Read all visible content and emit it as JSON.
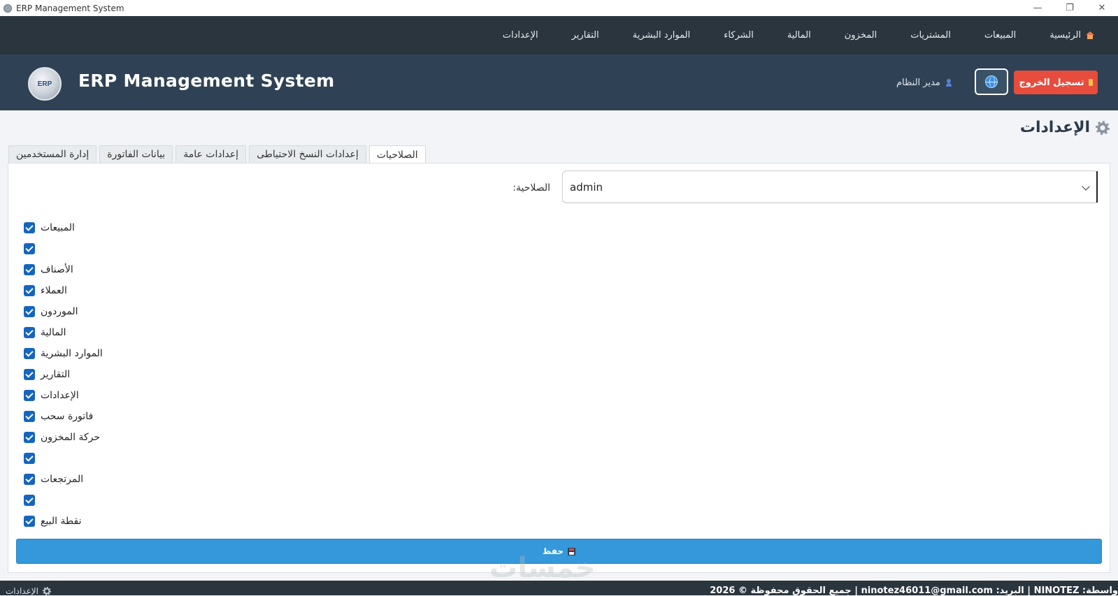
{
  "window": {
    "title": "ERP Management System",
    "controls": {
      "minimize": "—",
      "restore": "❐",
      "close": "✕"
    }
  },
  "nav": {
    "items": [
      {
        "label": "الرئيسية",
        "icon": "home-icon"
      },
      {
        "label": "المبيعات"
      },
      {
        "label": "المشتريات"
      },
      {
        "label": "المخزون"
      },
      {
        "label": "المالية"
      },
      {
        "label": "الشركاء"
      },
      {
        "label": "الموارد البشرية"
      },
      {
        "label": "التقارير"
      },
      {
        "label": "الإعدادات"
      }
    ]
  },
  "header": {
    "logo_text": "ERP",
    "app_title": "ERP Management System",
    "logout_label": "تسجيل الخروج",
    "user_label": "مدير النظام",
    "logout_color": "#e74c3c"
  },
  "page": {
    "title": "الإعدادات",
    "tabs": [
      {
        "label": "الصلاحيات",
        "active": true
      },
      {
        "label": "إعدادات النسخ الاحتياطى"
      },
      {
        "label": "إعدادات عامة"
      },
      {
        "label": "بيانات الفاتورة"
      },
      {
        "label": "إدارة المستخدمين"
      }
    ]
  },
  "permissions": {
    "role_label": "الصلاحية:",
    "role_value": "admin",
    "items": [
      {
        "label": "المبيعات",
        "checked": true
      },
      {
        "label": "",
        "checked": true
      },
      {
        "label": "الأصناف",
        "checked": true
      },
      {
        "label": "العملاء",
        "checked": true
      },
      {
        "label": "الموردون",
        "checked": true
      },
      {
        "label": "المالية",
        "checked": true
      },
      {
        "label": "الموارد البشرية",
        "checked": true
      },
      {
        "label": "التقارير",
        "checked": true
      },
      {
        "label": "الإعدادات",
        "checked": true
      },
      {
        "label": "فاتورة سحب",
        "checked": true
      },
      {
        "label": "حركة المخزون",
        "checked": true
      },
      {
        "label": "",
        "checked": true
      },
      {
        "label": "المرتجعات",
        "checked": true
      },
      {
        "label": "",
        "checked": true
      },
      {
        "label": "نقطة البيع",
        "checked": true
      }
    ],
    "save_label": "حفظ",
    "save_color": "#3498db",
    "checkbox_color": "#1565c0"
  },
  "watermark": "خمسات",
  "footer": {
    "copyright": "واسطة: NINOTEZ | البريد: ninotez46011@gmail.com | جميع الحقوق محفوظة © 2026",
    "settings_label": "الإعدادات"
  }
}
